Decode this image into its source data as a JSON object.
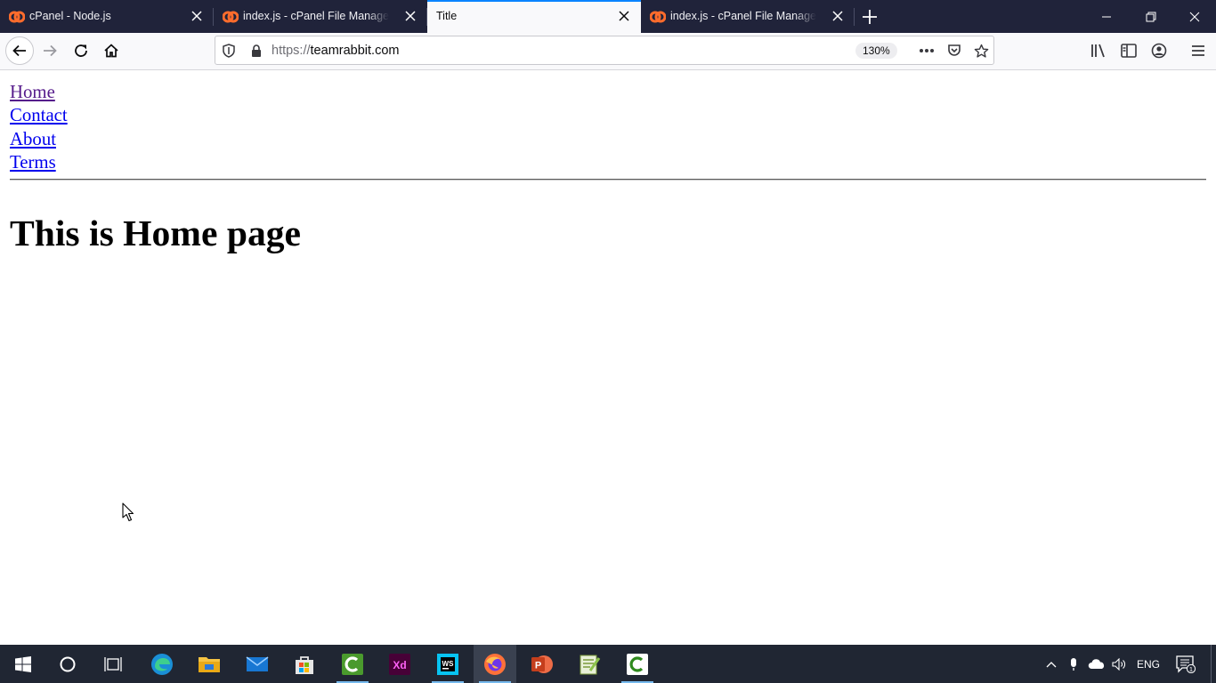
{
  "browser": {
    "tabs": [
      {
        "title": "cPanel - Node.js",
        "favicon": "cpanel-icon",
        "active": false
      },
      {
        "title": "index.js - cPanel File Manager v",
        "favicon": "cpanel-icon",
        "active": false
      },
      {
        "title": "Title",
        "favicon": "",
        "active": true
      },
      {
        "title": "index.js - cPanel File Manager v",
        "favicon": "cpanel-icon",
        "active": false
      }
    ],
    "url": {
      "scheme": "https://",
      "host": "teamrabbit.com"
    },
    "zoom": "130%",
    "accent_color": "#0a84ff",
    "tabbar_color": "#20233a"
  },
  "page": {
    "nav_links": [
      "Home",
      "Contact",
      "About",
      "Terms"
    ],
    "heading": "This is Home page"
  },
  "taskbar": {
    "apps": [
      "start-icon",
      "cortana-search-icon",
      "task-view-icon",
      "edge-icon",
      "file-explorer-icon",
      "mail-icon",
      "store-icon",
      "camtasia-icon",
      "adobe-xd-icon",
      "webstorm-icon",
      "firefox-icon",
      "powerpoint-icon",
      "notepad-plus-plus-icon",
      "camtasia-recorder-icon"
    ],
    "language": "ENG",
    "notification_count": "1"
  }
}
